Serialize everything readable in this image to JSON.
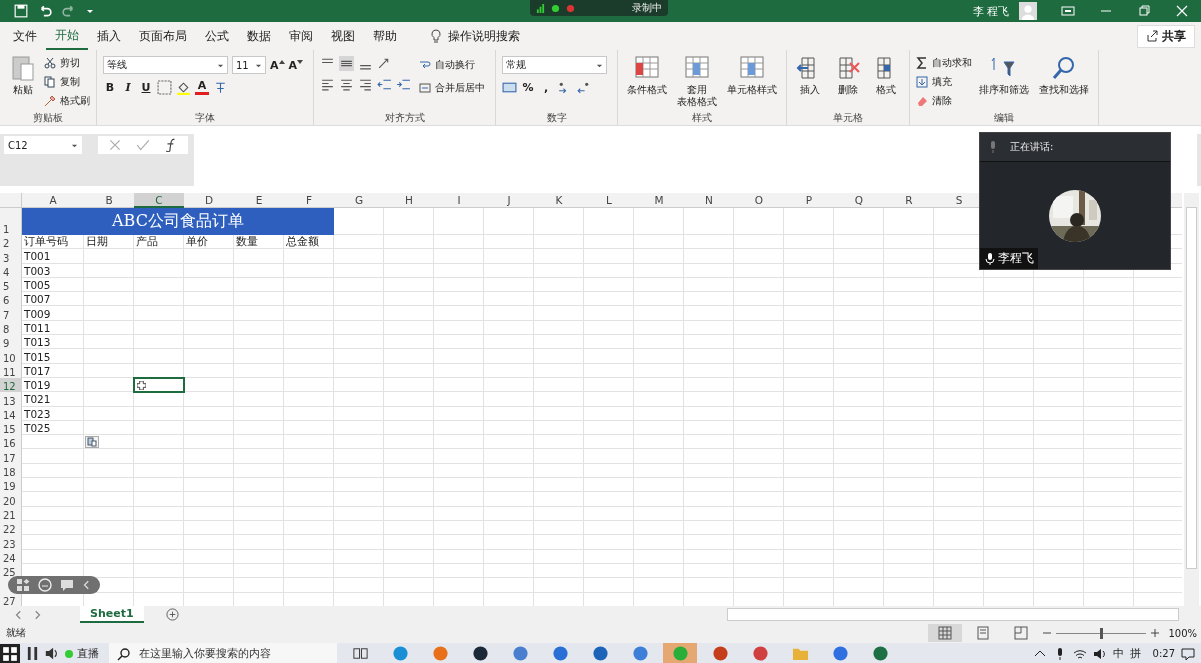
{
  "title_bar": {
    "user": "李 程飞",
    "recording": "录制中"
  },
  "tabs": [
    {
      "label": "文件",
      "selected": false
    },
    {
      "label": "开始",
      "selected": true
    },
    {
      "label": "插入",
      "selected": false
    },
    {
      "label": "页面布局",
      "selected": false
    },
    {
      "label": "公式",
      "selected": false
    },
    {
      "label": "数据",
      "selected": false
    },
    {
      "label": "审阅",
      "selected": false
    },
    {
      "label": "视图",
      "selected": false
    },
    {
      "label": "帮助",
      "selected": false
    }
  ],
  "tell_me": "操作说明搜索",
  "share": "共享",
  "ribbon": {
    "clipboard": {
      "paste": "粘贴",
      "items": [
        "剪切",
        "复制",
        "格式刷"
      ],
      "label": "剪贴板"
    },
    "font": {
      "name": "等线",
      "size": "11",
      "grow": "A",
      "shrink": "A",
      "styles": [
        "B",
        "I",
        "U"
      ],
      "font_color_button": "A",
      "label": "字体"
    },
    "alignment": {
      "wrap": "自动换行",
      "merge": "合并后居中",
      "label": "对齐方式"
    },
    "number": {
      "format": "常规",
      "percent": "%",
      "comma": ",",
      "label": "数字"
    },
    "styles": {
      "items": [
        {
          "lines": [
            "条件格式"
          ]
        },
        {
          "lines": [
            "套用",
            "表格格式"
          ]
        },
        {
          "lines": [
            "单元格样式"
          ]
        }
      ],
      "label": "样式"
    },
    "cells": {
      "items": [
        "插入",
        "删除",
        "格式"
      ],
      "label": "单元格"
    },
    "editing": {
      "items": [
        "自动求和",
        "填充",
        "清除"
      ],
      "big": [
        "排序和筛选",
        "查找和选择"
      ],
      "label": "编辑"
    }
  },
  "formula_bar": {
    "name_box": "C12"
  },
  "sheet": {
    "columns": [
      {
        "label": "A",
        "selected": false
      },
      {
        "label": "B",
        "selected": false
      },
      {
        "label": "C",
        "selected": true
      },
      {
        "label": "D",
        "selected": false
      },
      {
        "label": "E",
        "selected": false
      },
      {
        "label": "F",
        "selected": false
      },
      {
        "label": "G",
        "selected": false
      },
      {
        "label": "H",
        "selected": false
      },
      {
        "label": "I",
        "selected": false
      },
      {
        "label": "J",
        "selected": false
      },
      {
        "label": "K",
        "selected": false
      },
      {
        "label": "L",
        "selected": false
      },
      {
        "label": "M",
        "selected": false
      },
      {
        "label": "N",
        "selected": false
      },
      {
        "label": "O",
        "selected": false
      },
      {
        "label": "P",
        "selected": false
      },
      {
        "label": "Q",
        "selected": false
      },
      {
        "label": "R",
        "selected": false
      },
      {
        "label": "S",
        "selected": false
      }
    ],
    "rows": [
      {
        "label": "1",
        "selected": false,
        "title": "ABC公司食品订单"
      },
      {
        "label": "2",
        "selected": false,
        "cells": [
          "订单号码",
          "日期",
          "产品",
          "单价",
          "数量",
          "总金额"
        ]
      },
      {
        "label": "3",
        "selected": false,
        "cells": [
          "T001"
        ]
      },
      {
        "label": "4",
        "selected": false,
        "cells": [
          "T003"
        ]
      },
      {
        "label": "5",
        "selected": false,
        "cells": [
          "T005"
        ]
      },
      {
        "label": "6",
        "selected": false,
        "cells": [
          "T007"
        ]
      },
      {
        "label": "7",
        "selected": false,
        "cells": [
          "T009"
        ]
      },
      {
        "label": "8",
        "selected": false,
        "cells": [
          "T011"
        ]
      },
      {
        "label": "9",
        "selected": false,
        "cells": [
          "T013"
        ]
      },
      {
        "label": "10",
        "selected": false,
        "cells": [
          "T015"
        ]
      },
      {
        "label": "11",
        "selected": false,
        "cells": [
          "T017"
        ]
      },
      {
        "label": "12",
        "selected": true,
        "cells": [
          "T019"
        ]
      },
      {
        "label": "13",
        "selected": false,
        "cells": [
          "T021"
        ]
      },
      {
        "label": "14",
        "selected": false,
        "cells": [
          "T023"
        ]
      },
      {
        "label": "15",
        "selected": false,
        "cells": [
          "T025"
        ]
      },
      {
        "label": "16",
        "selected": false,
        "paste_options": true
      },
      {
        "label": "17",
        "selected": false
      },
      {
        "label": "18",
        "selected": false
      },
      {
        "label": "19",
        "selected": false
      },
      {
        "label": "20",
        "selected": false
      },
      {
        "label": "21",
        "selected": false
      },
      {
        "label": "22",
        "selected": false
      },
      {
        "label": "23",
        "selected": false
      },
      {
        "label": "24",
        "selected": false
      },
      {
        "label": "25",
        "selected": false
      },
      {
        "selected": false
      },
      {
        "label": "27",
        "selected": false
      }
    ]
  },
  "sheet_tabs": [
    {
      "label": "Sheet1",
      "selected": true
    }
  ],
  "status_bar": {
    "text": "就绪",
    "views": [
      {
        "kind": "normal",
        "selected": true
      },
      {
        "kind": "page_layout",
        "selected": false
      },
      {
        "kind": "page_break",
        "selected": false
      }
    ],
    "zoom": {
      "level": 0.5,
      "reading": "100%"
    }
  },
  "taskbar": {
    "search_placeholder": "在这里输入你要搜索的内容",
    "apps": [
      {
        "kind": "task_view",
        "selected": false
      },
      {
        "kind": "edge",
        "selected": false
      },
      {
        "kind": "orange_ball",
        "selected": false
      },
      {
        "kind": "steam",
        "selected": false
      },
      {
        "kind": "rings",
        "selected": false
      },
      {
        "kind": "blue_circle",
        "selected": false
      },
      {
        "kind": "plane",
        "selected": false
      },
      {
        "kind": "swirl",
        "selected": false
      },
      {
        "kind": "chat",
        "selected": true
      },
      {
        "kind": "powerpoint",
        "selected": false
      },
      {
        "kind": "paint",
        "selected": false
      },
      {
        "kind": "folder",
        "selected": false
      },
      {
        "kind": "meeting",
        "selected": false
      },
      {
        "kind": "excel",
        "selected": false
      }
    ],
    "tray": [
      "中",
      "拼"
    ],
    "time": "0:27"
  },
  "meeting": {
    "live": "直播",
    "speaking_label": "正在讲话:",
    "speaker": "李程飞"
  }
}
